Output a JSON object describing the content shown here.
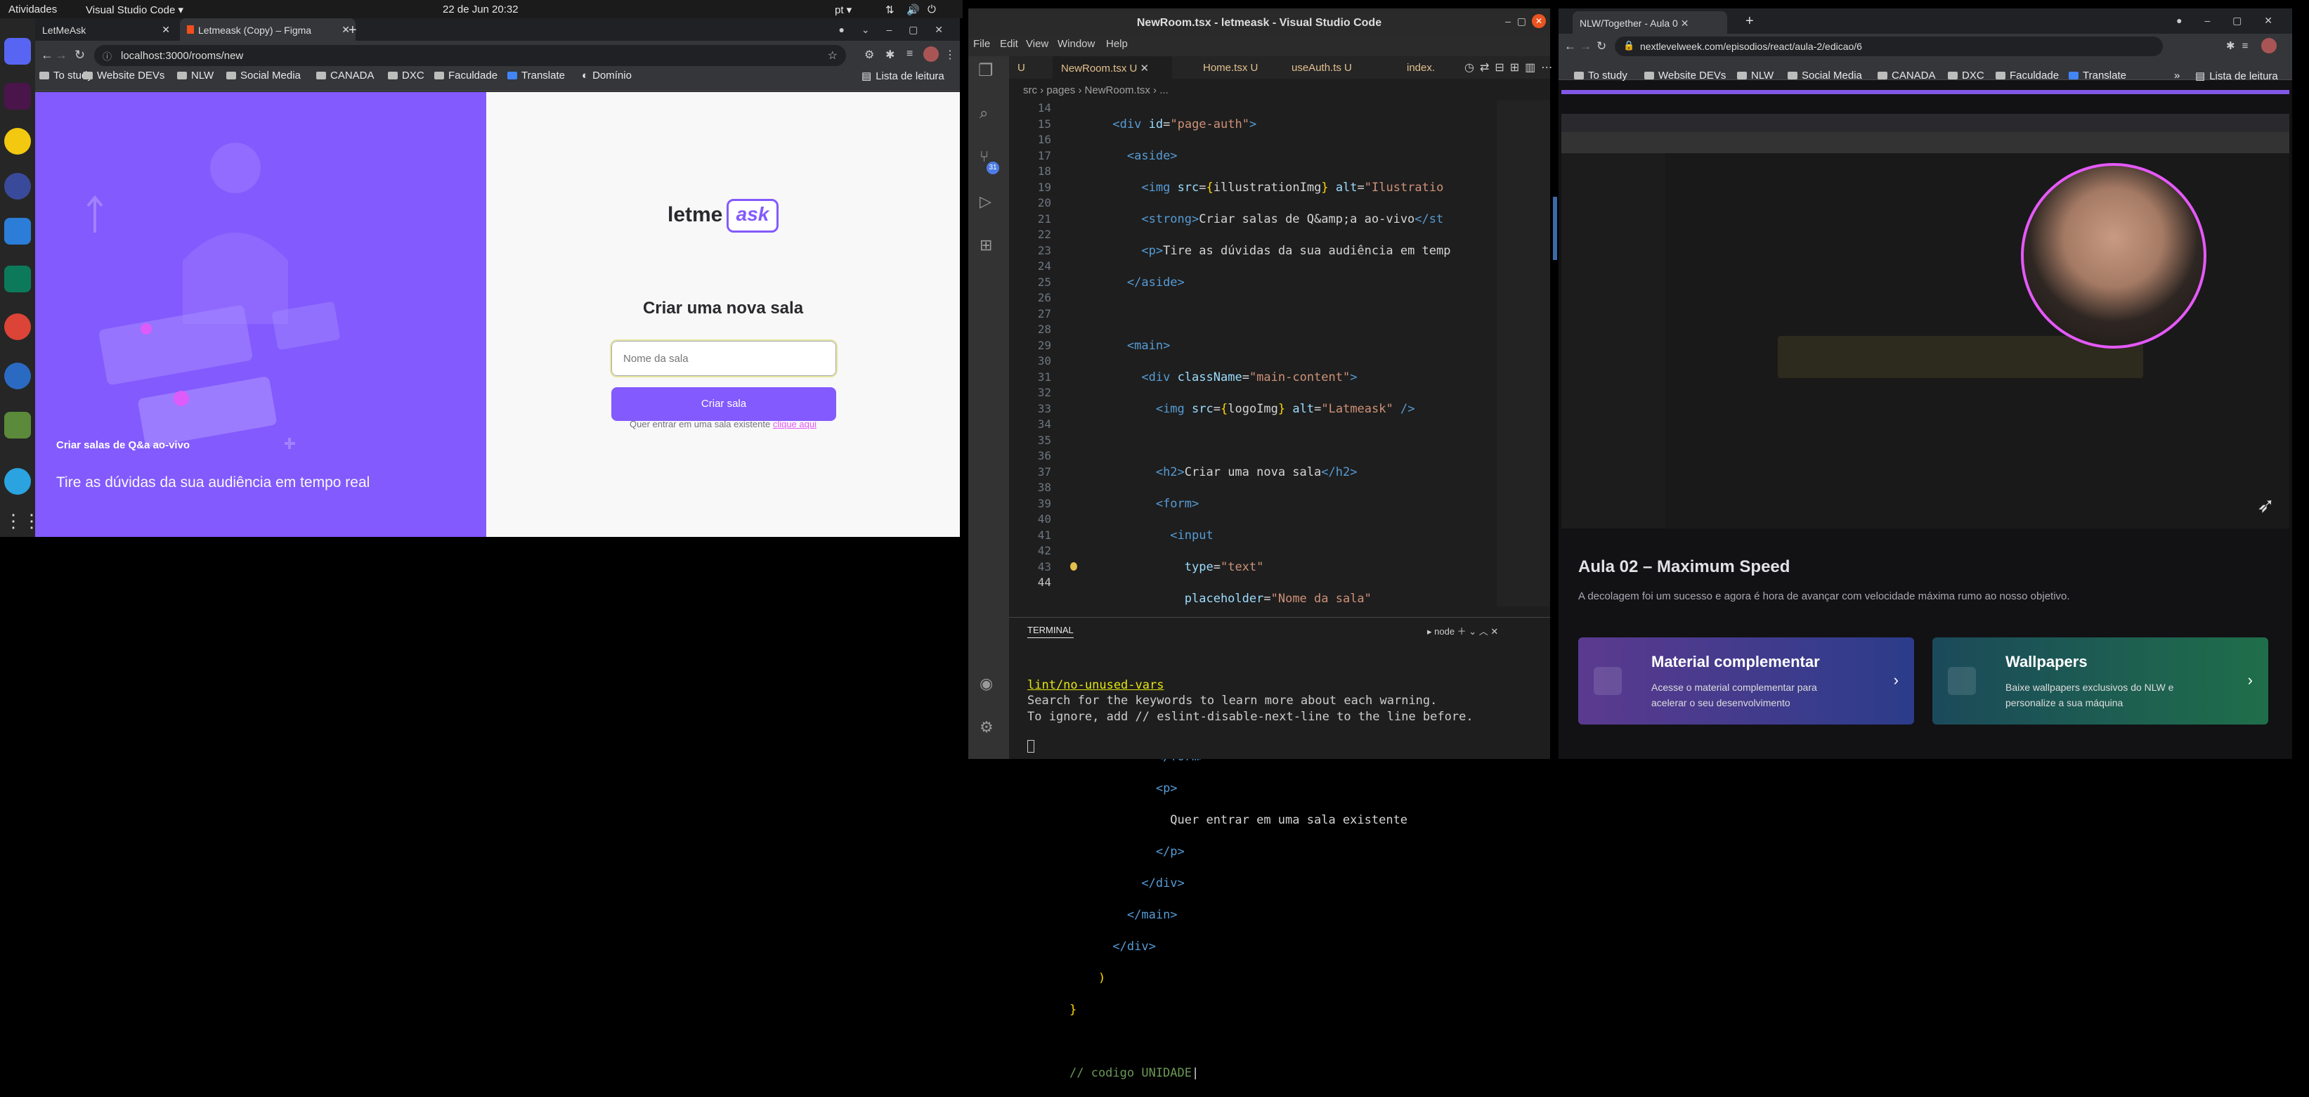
{
  "topbar": {
    "activities": "Atividades",
    "app": "Visual Studio Code ▾",
    "datetime": "22 de Jun  20:32",
    "lang": "pt ▾"
  },
  "left_browser": {
    "tabs": [
      {
        "label": "LetMeAsk"
      },
      {
        "label": "Letmeask (Copy) – Figma"
      }
    ],
    "url": "localhost:3000/rooms/new",
    "bookmarks": [
      "To study",
      "Website DEVs",
      "NLW",
      "Social Media",
      "CANADA",
      "DXC",
      "Faculdade",
      "Translate",
      "Domínio"
    ],
    "reading_list": "Lista de leitura",
    "page": {
      "aside_title": "Criar salas de Q&a ao-vivo",
      "aside_text": "Tire as dúvidas da sua audiência em tempo real",
      "logo_text": "letme",
      "logo_bubble": "ask",
      "heading": "Criar uma nova sala",
      "input_placeholder": "Nome da sala",
      "button": "Criar sala",
      "footer_text": "Quer entrar em uma sala existente",
      "footer_link": "clique aqui"
    }
  },
  "vscode": {
    "title": "NewRoom.tsx - letmeask - Visual Studio Code",
    "menu": [
      "File",
      "Edit",
      "View",
      "Window",
      "Help"
    ],
    "tabs": [
      "U",
      "NewRoom.tsx U",
      "Home.tsx U",
      "useAuth.ts U",
      "index."
    ],
    "breadcrumb": "src › pages › NewRoom.tsx › ...",
    "scm_badge": "31",
    "line_numbers": [
      "14",
      "15",
      "16",
      "17",
      "18",
      "19",
      "20",
      "21",
      "22",
      "23",
      "24",
      "25",
      "26",
      "27",
      "28",
      "29",
      "30",
      "31",
      "32",
      "33",
      "34",
      "35",
      "36",
      "37",
      "38",
      "39",
      "40",
      "41",
      "42",
      "43",
      "44"
    ],
    "panel_title": "TERMINAL",
    "panel_shell": "node",
    "terminal": [
      "lint/no-unused-vars",
      "",
      "Search for the keywords to learn more about each warning.",
      "To ignore, add // eslint-disable-next-line to the line before."
    ]
  },
  "right_browser": {
    "tab": "NLW/Together - Aula 0",
    "url": "nextlevelweek.com/episodios/react/aula-2/edicao/6",
    "bookmarks": [
      "To study",
      "Website DEVs",
      "NLW",
      "Social Media",
      "CANADA",
      "DXC",
      "Faculdade",
      "Translate"
    ],
    "reading_list": "Lista de leitura",
    "lesson_title": "Aula 02 – Maximum Speed",
    "lesson_desc": "A decolagem foi um sucesso e agora é hora de avançar com velocidade máxima rumo ao nosso objetivo.",
    "cards": [
      {
        "title": "Material complementar",
        "desc": "Acesse o material complementar para acelerar o seu desenvolvimento"
      },
      {
        "title": "Wallpapers",
        "desc": "Baixe wallpapers exclusivos do NLW e personalize a sua máquina"
      }
    ]
  },
  "colors": {
    "purple": "#835afd",
    "pink": "#e559f9",
    "vs_bg": "#1e1e1e",
    "nlw_bg": "#121214"
  }
}
